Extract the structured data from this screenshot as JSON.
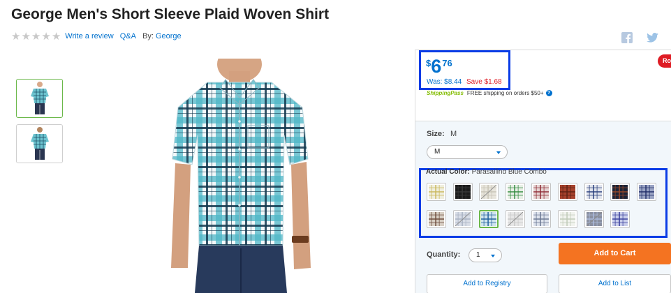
{
  "product": {
    "title": "George Men's Short Sleeve Plaid Woven Shirt",
    "rating_stars": 0,
    "write_review": "Write a review",
    "qa": "Q&A",
    "by_label": "By:",
    "brand": "George"
  },
  "social": {
    "facebook_icon": "facebook-icon",
    "twitter_icon": "twitter-icon"
  },
  "price": {
    "currency": "$",
    "dollars": "6",
    "cents": "76",
    "was": "Was: $8.44",
    "save": "Save $1.68",
    "badge": "Ro"
  },
  "shipping": {
    "logo": "ShippingPass",
    "text": "FREE shipping on orders $50+",
    "help": "?"
  },
  "size": {
    "label": "Size:",
    "value": "M",
    "selected": "M"
  },
  "color": {
    "label": "Actual Color:",
    "value": "Parasailing Blue Combo",
    "swatches": [
      {
        "name": "cream-yellow",
        "base": "#efeede",
        "line": "#c9b75a",
        "disabled": false
      },
      {
        "name": "black",
        "base": "#1b1b1b",
        "line": "#3a3a3a",
        "disabled": false
      },
      {
        "name": "khaki",
        "base": "#d6cfbf",
        "line": "#9b927a",
        "disabled": true
      },
      {
        "name": "green-plaid",
        "base": "#e8efe6",
        "line": "#2f8a3c",
        "disabled": false
      },
      {
        "name": "burgundy",
        "base": "#e5d3d2",
        "line": "#8e2a35",
        "disabled": false
      },
      {
        "name": "red-brown",
        "base": "#a6412c",
        "line": "#5e2315",
        "disabled": false
      },
      {
        "name": "navy-check",
        "base": "#e0e3ec",
        "line": "#273d7a",
        "disabled": false
      },
      {
        "name": "dark-navy",
        "base": "#1d2436",
        "line": "#9c4a2a",
        "disabled": false
      },
      {
        "name": "blue-stripe",
        "base": "#9aa4c4",
        "line": "#1f2c66",
        "disabled": false
      },
      {
        "name": "brown-plaid",
        "base": "#d8cfc4",
        "line": "#6c4a3a",
        "disabled": false
      },
      {
        "name": "slate",
        "base": "#b9c2d3",
        "line": "#607090",
        "disabled": true
      },
      {
        "name": "parasailing-blue",
        "base": "#cfe4ee",
        "line": "#1d5f9c",
        "disabled": false
      },
      {
        "name": "grey",
        "base": "#d3d3d3",
        "line": "#9a9a9a",
        "disabled": true
      },
      {
        "name": "light-blue-grey",
        "base": "#dde2ec",
        "line": "#6a7792",
        "disabled": false
      },
      {
        "name": "pale-check",
        "base": "#f1f3ee",
        "line": "#bfc9b7",
        "disabled": false
      },
      {
        "name": "navy-blue",
        "base": "#2b3552",
        "line": "#6a87c4",
        "disabled": true
      },
      {
        "name": "blue-purple",
        "base": "#c8cdea",
        "line": "#3a3e9c",
        "disabled": false
      }
    ],
    "selected_index": 11
  },
  "quantity": {
    "label": "Quantity:",
    "value": "1"
  },
  "actions": {
    "add_to_cart": "Add to Cart",
    "add_to_registry": "Add to Registry",
    "add_to_list": "Add to List"
  },
  "colors": {
    "accent_blue": "#0071ce",
    "cart_orange": "#f47321",
    "save_red": "#de1c24",
    "selected_green": "#6bb84a",
    "highlight_box": "#0a3ce6"
  }
}
